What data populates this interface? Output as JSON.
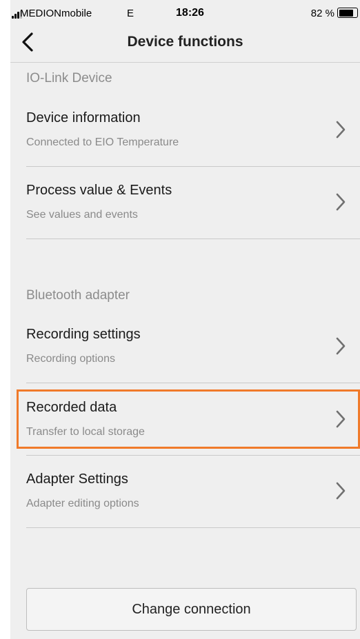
{
  "status_bar": {
    "carrier": "MEDIONmobile",
    "network": "E",
    "time": "18:26",
    "battery_text": "82 %",
    "battery_level": 0.82
  },
  "nav": {
    "title": "Device functions",
    "back_icon": "chevron-left-icon"
  },
  "sections": [
    {
      "header": "IO-Link Device",
      "items": [
        {
          "title": "Device information",
          "subtitle": "Connected to EIO Temperature"
        },
        {
          "title": "Process value & Events",
          "subtitle": "See values and events"
        }
      ]
    },
    {
      "header": "Bluetooth adapter",
      "items": [
        {
          "title": "Recording settings",
          "subtitle": "Recording options"
        },
        {
          "title": "Recorded data",
          "subtitle": "Transfer to local storage"
        },
        {
          "title": "Adapter Settings",
          "subtitle": "Adapter editing options"
        }
      ]
    }
  ],
  "highlight_color": "#f07a2a",
  "change_connection_label": "Change connection"
}
